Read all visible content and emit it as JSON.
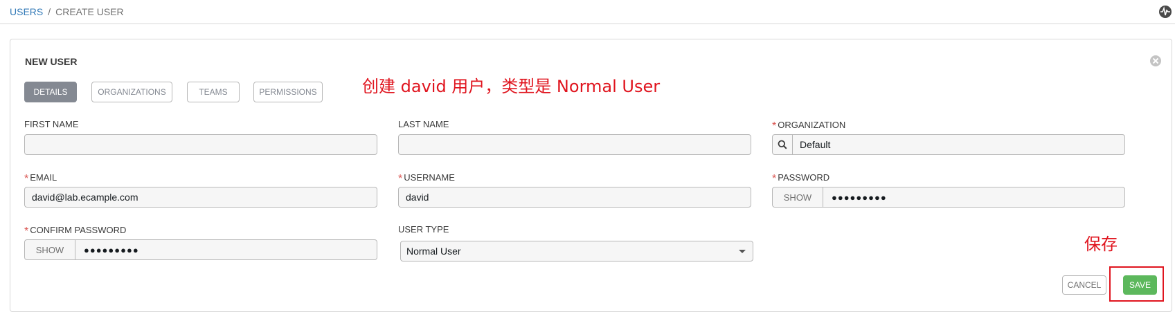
{
  "breadcrumb": {
    "parent": "USERS",
    "separator": "/",
    "current": "CREATE USER"
  },
  "panel": {
    "title": "NEW USER"
  },
  "tabs": [
    {
      "label": "DETAILS",
      "active": true
    },
    {
      "label": "ORGANIZATIONS",
      "active": false
    },
    {
      "label": "TEAMS",
      "active": false
    },
    {
      "label": "PERMISSIONS",
      "active": false
    }
  ],
  "required_marker": "*",
  "fields": {
    "first_name": {
      "label": "FIRST NAME",
      "value": ""
    },
    "last_name": {
      "label": "LAST NAME",
      "value": ""
    },
    "organization": {
      "label": "ORGANIZATION",
      "value": "Default"
    },
    "email": {
      "label": "EMAIL",
      "value": "david@lab.ecample.com"
    },
    "username": {
      "label": "USERNAME",
      "value": "david"
    },
    "password": {
      "label": "PASSWORD",
      "show_label": "SHOW",
      "masked": "●●●●●●●●●"
    },
    "confirm_password": {
      "label": "CONFIRM PASSWORD",
      "show_label": "SHOW",
      "masked": "●●●●●●●●●"
    },
    "user_type": {
      "label": "USER TYPE",
      "value": "Normal User"
    }
  },
  "buttons": {
    "cancel": "CANCEL",
    "save": "SAVE"
  },
  "annotations": {
    "note": "创建 david 用户，类型是 Normal User",
    "save_note": "保存",
    "color": "#e0141e"
  },
  "colors": {
    "link": "#337ab7",
    "tab_active": "#848992",
    "save": "#5cb85c",
    "required": "#d9534f"
  },
  "icons": [
    "activity-icon",
    "close-icon",
    "search-icon",
    "chevron-down-icon"
  ]
}
